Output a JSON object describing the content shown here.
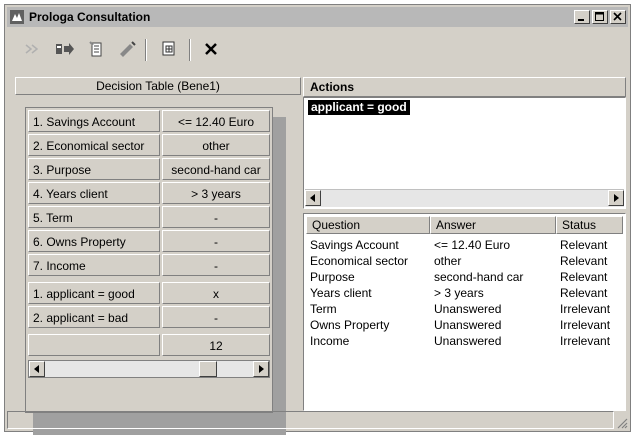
{
  "window": {
    "title": "Prologa Consultation"
  },
  "toolbar": {
    "icons": [
      "back-arrows-icon",
      "forward-arrow-icon",
      "print-preview-icon",
      "erase-icon",
      "copy-table-icon",
      "close-x-icon"
    ]
  },
  "decision_table": {
    "header": "Decision Table (Bene1)",
    "condition_rows": [
      {
        "label": "1.  Savings Account",
        "value": "<= 12.40 Euro"
      },
      {
        "label": "2.  Economical sector",
        "value": "other"
      },
      {
        "label": "3.  Purpose",
        "value": "second-hand car"
      },
      {
        "label": "4.  Years client",
        "value": "> 3 years"
      },
      {
        "label": "5.  Term",
        "value": "-"
      },
      {
        "label": "6.  Owns Property",
        "value": "-"
      },
      {
        "label": "7.  Income",
        "value": "-"
      }
    ],
    "action_rows": [
      {
        "label": "1.  applicant = good",
        "value": "x"
      },
      {
        "label": "2.  applicant = bad",
        "value": "-"
      }
    ],
    "column_number": "12"
  },
  "actions": {
    "header": "Actions",
    "items": [
      "applicant = good"
    ]
  },
  "questions": {
    "columns": [
      "Question",
      "Answer",
      "Status"
    ],
    "rows": [
      {
        "question": "Savings Account",
        "answer": "<= 12.40 Euro",
        "status": "Relevant"
      },
      {
        "question": "Economical sector",
        "answer": "other",
        "status": "Relevant"
      },
      {
        "question": "Purpose",
        "answer": "second-hand car",
        "status": "Relevant"
      },
      {
        "question": "Years client",
        "answer": "> 3 years",
        "status": "Relevant"
      },
      {
        "question": "Term",
        "answer": "Unanswered",
        "status": "Irrelevant"
      },
      {
        "question": "Owns Property",
        "answer": "Unanswered",
        "status": "Irrelevant"
      },
      {
        "question": "Income",
        "answer": "Unanswered",
        "status": "Irrelevant"
      }
    ]
  }
}
